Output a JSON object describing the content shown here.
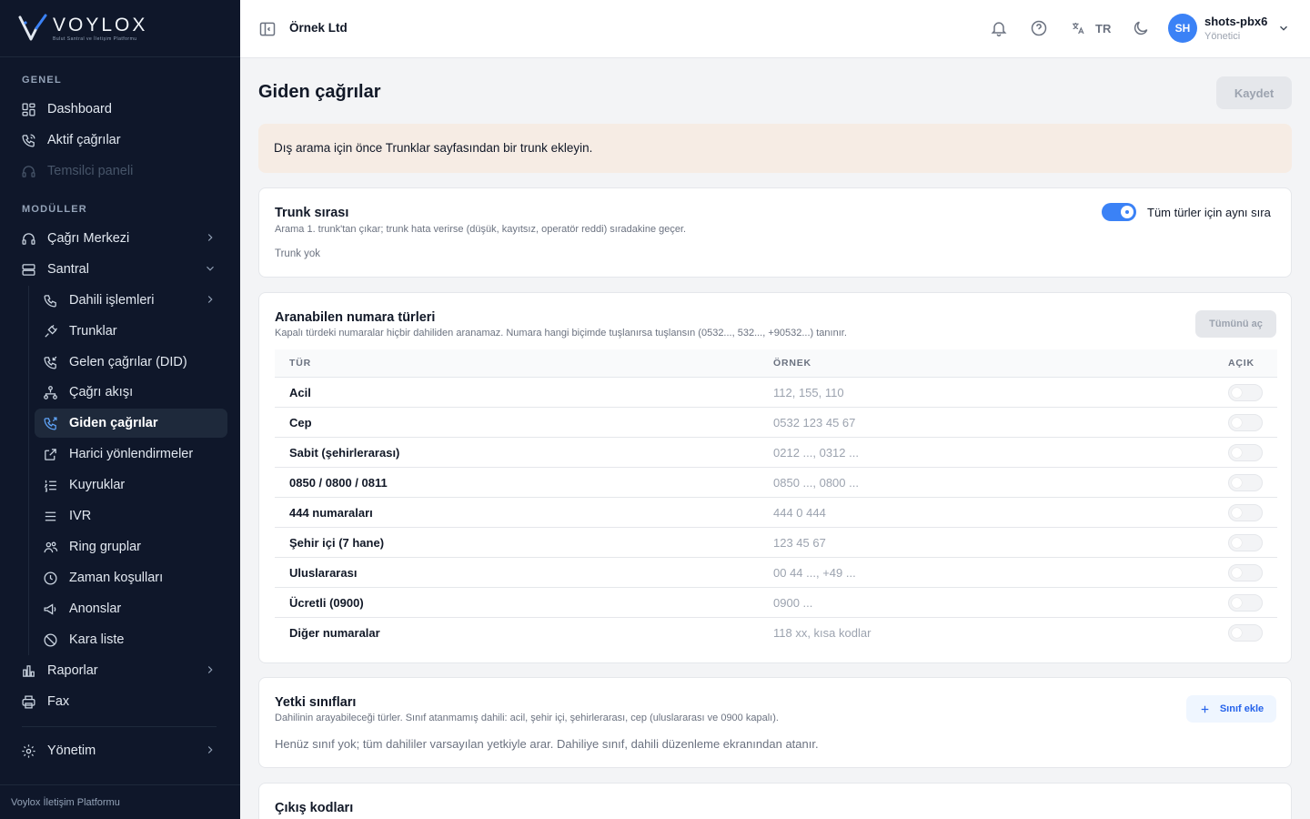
{
  "brand": {
    "name": "VOYLOX",
    "tagline": "Bulut Santral ve İletişim Platformu"
  },
  "sidebar": {
    "sections": {
      "general": "GENEL",
      "modules": "MODÜLLER"
    },
    "items": {
      "dashboard": "Dashboard",
      "active_calls": "Aktif çağrılar",
      "agent_panel": "Temsilci paneli",
      "call_center": "Çağrı Merkezi",
      "pbx": "Santral",
      "extensions": "Dahili işlemleri",
      "trunks": "Trunklar",
      "inbound": "Gelen çağrılar (DID)",
      "call_flow": "Çağrı akışı",
      "outbound": "Giden çağrılar",
      "external_forwarding": "Harici yönlendirmeler",
      "queues": "Kuyruklar",
      "ivr": "IVR",
      "ring_groups": "Ring gruplar",
      "time_conditions": "Zaman koşulları",
      "announcements": "Anonslar",
      "blacklist": "Kara liste",
      "reports": "Raporlar",
      "fax": "Fax",
      "admin": "Yönetim"
    },
    "footer": "Voylox İletişim Platformu"
  },
  "topbar": {
    "company": "Örnek Ltd",
    "lang": "TR",
    "user": {
      "initials": "SH",
      "name": "shots-pbx6",
      "role": "Yönetici"
    }
  },
  "page": {
    "title": "Giden çağrılar",
    "save_label": "Kaydet",
    "alert": "Dış arama için önce Trunklar sayfasından bir trunk ekleyin."
  },
  "trunk_order": {
    "title": "Trunk sırası",
    "desc": "Arama 1. trunk'tan çıkar; trunk hata verirse (düşük, kayıtsız, operatör reddi) sıradakine geçer.",
    "empty": "Trunk yok",
    "toggle_label": "Tüm türler için aynı sıra",
    "toggle_on": true
  },
  "number_types": {
    "title": "Aranabilen numara türleri",
    "desc": "Kapalı türdeki numaralar hiçbir dahiliden aranamaz. Numara hangi biçimde tuşlanırsa tuşlansın (0532..., 532..., +90532...) tanınır.",
    "open_all_label": "Tümünü aç",
    "columns": {
      "type": "TÜR",
      "example": "ÖRNEK",
      "open": "AÇIK"
    },
    "rows": [
      {
        "type": "Acil",
        "example": "112, 155, 110",
        "open": false
      },
      {
        "type": "Cep",
        "example": "0532 123 45 67",
        "open": false
      },
      {
        "type": "Sabit (şehirlerarası)",
        "example": "0212 ..., 0312 ...",
        "open": false
      },
      {
        "type": "0850 / 0800 / 0811",
        "example": "0850 ..., 0800 ...",
        "open": false
      },
      {
        "type": "444 numaraları",
        "example": "444 0 444",
        "open": false
      },
      {
        "type": "Şehir içi (7 hane)",
        "example": "123 45 67",
        "open": false
      },
      {
        "type": "Uluslararası",
        "example": "00 44 ..., +49 ...",
        "open": false
      },
      {
        "type": "Ücretli (0900)",
        "example": "0900 ...",
        "open": false
      },
      {
        "type": "Diğer numaralar",
        "example": "118 xx, kısa kodlar",
        "open": false
      }
    ]
  },
  "permission_classes": {
    "title": "Yetki sınıfları",
    "desc": "Dahilinin arayabileceği türler. Sınıf atanmamış dahili: acil, şehir içi, şehirlerarası, cep (uluslararası ve 0900 kapalı).",
    "add_label": "Sınıf ekle",
    "empty": "Henüz sınıf yok; tüm dahililer varsayılan yetkiyle arar. Dahiliye sınıf, dahili düzenleme ekranından atanır."
  },
  "exit_codes": {
    "title": "Çıkış kodları"
  },
  "colors": {
    "accent": "#3b82f6",
    "sidebar_bg": "#0f172a",
    "alert_bg": "#f6ece4"
  }
}
